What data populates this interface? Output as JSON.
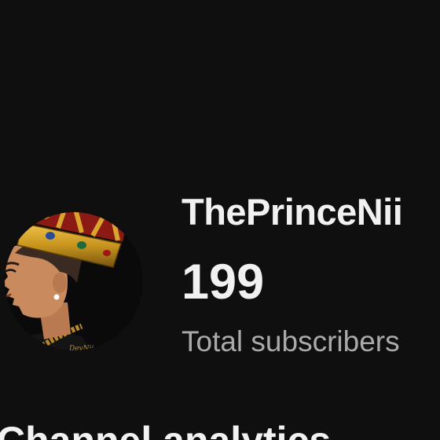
{
  "channel": {
    "name": "ThePrinceNii",
    "subscriber_count": "199",
    "subscriber_label": "Total subscribers",
    "avatar_icon": "crowned-prince-avatar-icon",
    "avatar_signature": "DevNii"
  },
  "section": {
    "title": "Channel analytics"
  },
  "colors": {
    "background": "#0f0f0f",
    "primary_text": "#f1f1f1",
    "secondary_text": "#aaaaaa",
    "crown_gold": "#c8961e",
    "crown_red": "#8b1a14"
  }
}
